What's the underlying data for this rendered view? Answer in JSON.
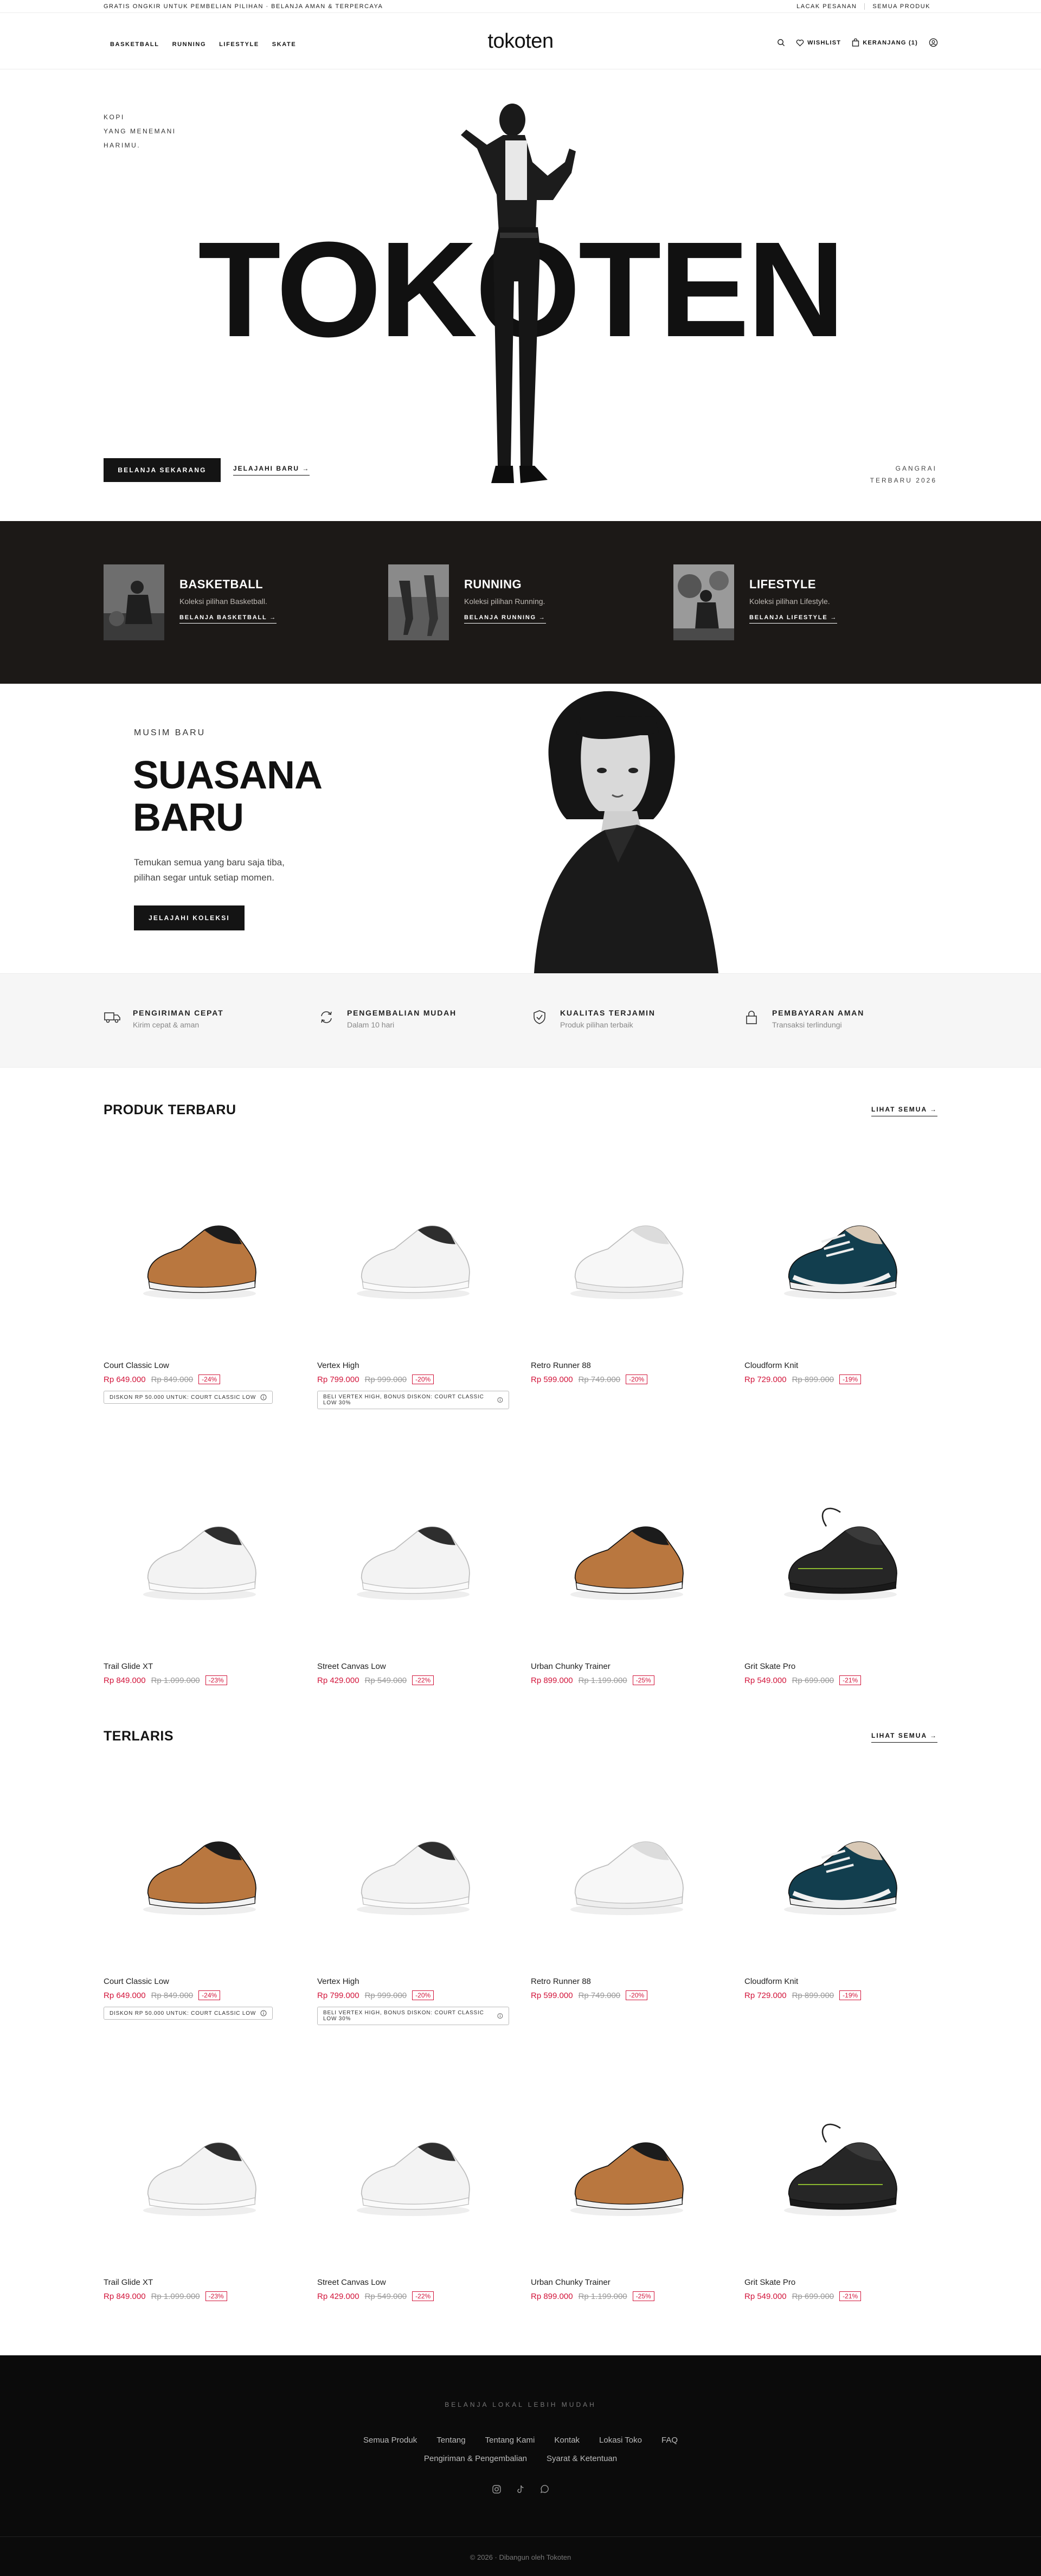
{
  "topbar": {
    "promo": "GRATIS ONGKIR UNTUK PEMBELIAN PILIHAN · BELANJA AMAN & TERPERCAYA",
    "track_order": "LACAK PESANAN",
    "all_products": "SEMUA PRODUK"
  },
  "header": {
    "nav": [
      "BASKETBALL",
      "RUNNING",
      "LIFESTYLE",
      "SKATE"
    ],
    "logo": "tokoten",
    "wishlist": "WISHLIST",
    "cart": "KERANJANG (1)"
  },
  "hero": {
    "tagline": [
      "KOPI",
      "YANG MENEMANI",
      "HARIMU."
    ],
    "title": "TOKOTEN",
    "cta_primary": "BELANJA SEKARANG",
    "cta_secondary": "JELAJAHI BARU →",
    "season_line1": "GANGRAI",
    "season_line2": "TERBARU 2026"
  },
  "categories": [
    {
      "title": "BASKETBALL",
      "subtitle": "Koleksi pilihan Basketball.",
      "link": "BELANJA BASKETBALL →"
    },
    {
      "title": "RUNNING",
      "subtitle": "Koleksi pilihan Running.",
      "link": "BELANJA RUNNING →"
    },
    {
      "title": "LIFESTYLE",
      "subtitle": "Koleksi pilihan Lifestyle.",
      "link": "BELANJA LIFESTYLE →"
    }
  ],
  "season": {
    "eyebrow": "MUSIM BARU",
    "title_line1": "SUASANA",
    "title_line2": "BARU",
    "desc_line1": "Temukan semua yang baru saja tiba,",
    "desc_line2": "pilihan segar untuk setiap momen.",
    "cta": "JELAJAHI KOLEKSI"
  },
  "features": [
    {
      "icon": "truck-icon",
      "title": "PENGIRIMAN CEPAT",
      "subtitle": "Kirim cepat & aman"
    },
    {
      "icon": "refresh-icon",
      "title": "PENGEMBALIAN MUDAH",
      "subtitle": "Dalam 10 hari"
    },
    {
      "icon": "shield-icon",
      "title": "KUALITAS TERJAMIN",
      "subtitle": "Produk pilihan terbaik"
    },
    {
      "icon": "lock-icon",
      "title": "PEMBAYARAN AMAN",
      "subtitle": "Transaksi terlindungi"
    }
  ],
  "latest": {
    "title": "PRODUK TERBARU",
    "more": "LIHAT SEMUA →",
    "products": [
      {
        "name": "Court Classic Low",
        "price": "Rp 649.000",
        "old": "Rp 849.000",
        "disc": "-24%",
        "promo": "DISKON RP 50.000 UNTUK: COURT CLASSIC LOW",
        "shoe": "tan"
      },
      {
        "name": "Vertex High",
        "price": "Rp 799.000",
        "old": "Rp 999.000",
        "disc": "-20%",
        "promo": "BELI VERTEX HIGH, BONUS DISKON: COURT CLASSIC LOW 30%",
        "shoe": "white"
      },
      {
        "name": "Retro Runner 88",
        "price": "Rp 599.000",
        "old": "Rp 749.000",
        "disc": "-20%",
        "promo": "",
        "shoe": "allwhite"
      },
      {
        "name": "Cloudform Knit",
        "price": "Rp 729.000",
        "old": "Rp 899.000",
        "disc": "-19%",
        "promo": "",
        "shoe": "teal"
      },
      {
        "name": "Trail Glide XT",
        "price": "Rp 849.000",
        "old": "Rp 1.099.000",
        "disc": "-23%",
        "promo": "",
        "shoe": "white"
      },
      {
        "name": "Street Canvas Low",
        "price": "Rp 429.000",
        "old": "Rp 549.000",
        "disc": "-22%",
        "promo": "",
        "shoe": "white"
      },
      {
        "name": "Urban Chunky Trainer",
        "price": "Rp 899.000",
        "old": "Rp 1.199.000",
        "disc": "-25%",
        "promo": "",
        "shoe": "tan"
      },
      {
        "name": "Grit Skate Pro",
        "price": "Rp 549.000",
        "old": "Rp 699.000",
        "disc": "-21%",
        "promo": "",
        "shoe": "black"
      }
    ]
  },
  "bestseller": {
    "title": "TERLARIS",
    "more": "LIHAT SEMUA →",
    "products": [
      {
        "name": "Court Classic Low",
        "price": "Rp 649.000",
        "old": "Rp 849.000",
        "disc": "-24%",
        "promo": "DISKON RP 50.000 UNTUK: COURT CLASSIC LOW",
        "shoe": "tan"
      },
      {
        "name": "Vertex High",
        "price": "Rp 799.000",
        "old": "Rp 999.000",
        "disc": "-20%",
        "promo": "BELI VERTEX HIGH, BONUS DISKON: COURT CLASSIC LOW 30%",
        "shoe": "white"
      },
      {
        "name": "Retro Runner 88",
        "price": "Rp 599.000",
        "old": "Rp 749.000",
        "disc": "-20%",
        "promo": "",
        "shoe": "allwhite"
      },
      {
        "name": "Cloudform Knit",
        "price": "Rp 729.000",
        "old": "Rp 899.000",
        "disc": "-19%",
        "promo": "",
        "shoe": "teal"
      },
      {
        "name": "Trail Glide XT",
        "price": "Rp 849.000",
        "old": "Rp 1.099.000",
        "disc": "-23%",
        "promo": "",
        "shoe": "white"
      },
      {
        "name": "Street Canvas Low",
        "price": "Rp 429.000",
        "old": "Rp 549.000",
        "disc": "-22%",
        "promo": "",
        "shoe": "white"
      },
      {
        "name": "Urban Chunky Trainer",
        "price": "Rp 899.000",
        "old": "Rp 1.199.000",
        "disc": "-25%",
        "promo": "",
        "shoe": "tan"
      },
      {
        "name": "Grit Skate Pro",
        "price": "Rp 549.000",
        "old": "Rp 699.000",
        "disc": "-21%",
        "promo": "",
        "shoe": "black"
      }
    ]
  },
  "footer": {
    "tagline": "BELANJA LOKAL LEBIH MUDAH",
    "links_row1": [
      "Semua Produk",
      "Tentang",
      "Tentang Kami",
      "Kontak",
      "Lokasi Toko",
      "FAQ"
    ],
    "links_row2": [
      "Pengiriman & Pengembalian",
      "Syarat & Ketentuan"
    ],
    "social": [
      "instagram-icon",
      "tiktok-icon",
      "whatsapp-icon"
    ],
    "copyright": "© 2026 · Dibangun oleh Tokoten"
  },
  "colors": {
    "accent": "#d2143a",
    "dark": "#1c1917",
    "ink": "#141414"
  }
}
